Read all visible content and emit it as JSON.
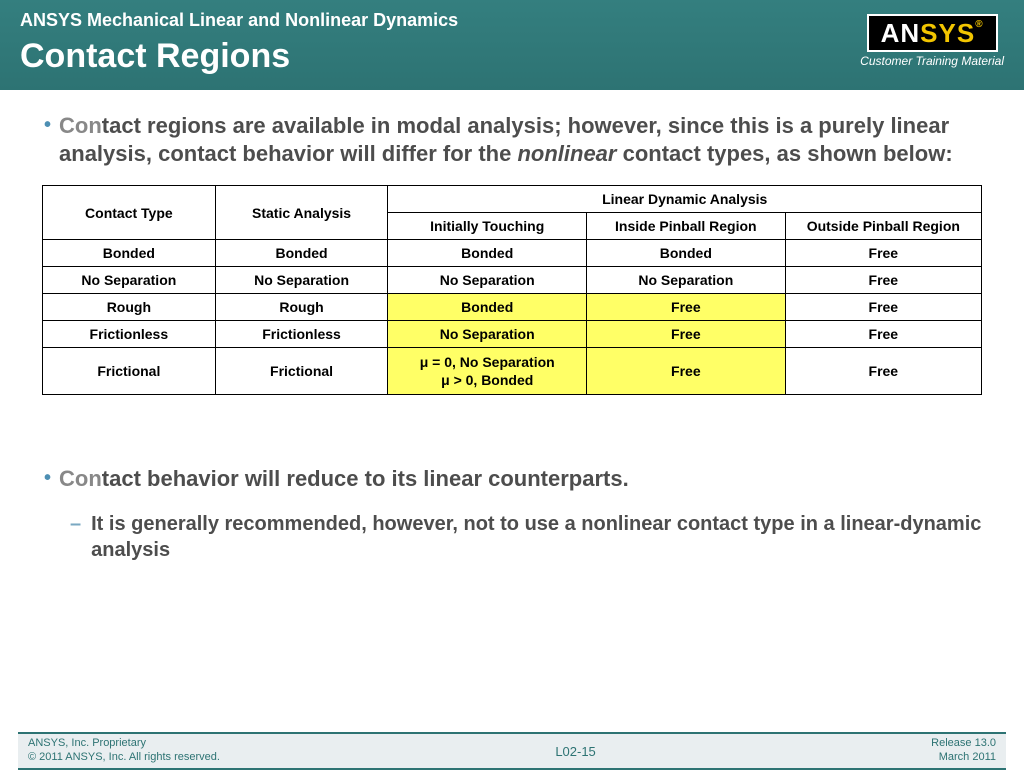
{
  "header": {
    "subtitle": "ANSYS Mechanical Linear and Nonlinear Dynamics",
    "title": "Contact Regions",
    "logo": {
      "part1": "AN",
      "part2": "SYS",
      "reg": "®",
      "tagline": "Customer Training Material"
    }
  },
  "bullets": {
    "b1_pre": "Con",
    "b1_rest": "tact regions are available in modal analysis; however, since this is a purely linear analysis, contact behavior will differ for the ",
    "b1_nl": "nonlinear",
    "b1_end": " contact types, as shown below:",
    "b2_pre": "Con",
    "b2_rest": "tact behavior will reduce to its linear counterparts.",
    "sub1": "It is generally recommended, however, not to use a nonlinear contact type in a linear-dynamic analysis"
  },
  "table": {
    "h_contact_type": "Contact Type",
    "h_static": "Static Analysis",
    "h_linear_group": "Linear Dynamic Analysis",
    "h_touching": "Initially Touching",
    "h_inside": "Inside Pinball Region",
    "h_outside": "Outside Pinball Region",
    "rows": [
      {
        "ct": "Bonded",
        "sa": "Bonded",
        "it": "Bonded",
        "ip": "Bonded",
        "op": "Free"
      },
      {
        "ct": "No Separation",
        "sa": "No Separation",
        "it": "No Separation",
        "ip": "No Separation",
        "op": "Free"
      },
      {
        "ct": "Rough",
        "sa": "Rough",
        "it": "Bonded",
        "ip": "Free",
        "op": "Free",
        "hl_it": true,
        "hl_ip": true
      },
      {
        "ct": "Frictionless",
        "sa": "Frictionless",
        "it": "No Separation",
        "ip": "Free",
        "op": "Free",
        "hl_it": true,
        "hl_ip": true
      },
      {
        "ct": "Frictional",
        "sa": "Frictional",
        "it_l1": "μ = 0, No Separation",
        "it_l2": "μ > 0, Bonded",
        "ip": "Free",
        "op": "Free",
        "hl_it": true,
        "hl_ip": true,
        "multiline": true
      }
    ]
  },
  "footer": {
    "left_l1": "ANSYS, Inc. Proprietary",
    "left_l2": "© 2011 ANSYS, Inc.  All rights reserved.",
    "center": "L02-15",
    "right_l1": "Release 13.0",
    "right_l2": "March 2011"
  }
}
